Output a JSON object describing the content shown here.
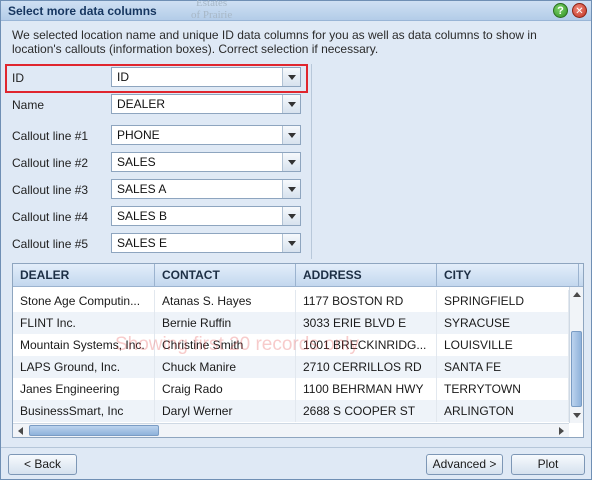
{
  "window": {
    "title": "Select more data columns",
    "map_ghost_line1": "Estates",
    "map_ghost_line2": "of Prairie",
    "help_symbol": "?",
    "close_symbol": "✕"
  },
  "intro_text": "We selected location name and unique ID data columns for you as well as data columns to show in location's callouts (information boxes). Correct selection if necessary.",
  "fields": [
    {
      "label": "ID",
      "value": "ID"
    },
    {
      "label": "Name",
      "value": "DEALER"
    },
    {
      "label": "Callout line #1",
      "value": "PHONE"
    },
    {
      "label": "Callout line #2",
      "value": "SALES"
    },
    {
      "label": "Callout line #3",
      "value": "SALES A"
    },
    {
      "label": "Callout line #4",
      "value": "SALES B"
    },
    {
      "label": "Callout line #5",
      "value": "SALES E"
    }
  ],
  "grid": {
    "columns": [
      "DEALER",
      "CONTACT",
      "ADDRESS",
      "CITY"
    ],
    "rows": [
      [
        "Stone Age Computin...",
        "Atanas S. Hayes",
        "1177 BOSTON RD",
        "SPRINGFIELD"
      ],
      [
        "FLINT Inc.",
        "Bernie Ruffin",
        "3033 ERIE BLVD E",
        "SYRACUSE"
      ],
      [
        "Mountain Systems, Inc.",
        "Christine Smith",
        "1001 BRECKINRIDG...",
        "LOUISVILLE"
      ],
      [
        "LAPS Ground, Inc.",
        "Chuck Manire",
        "2710 CERRILLOS RD",
        "SANTA FE"
      ],
      [
        "Janes Engineering",
        "Craig Rado",
        "1100 BEHRMAN HWY",
        "TERRYTOWN"
      ],
      [
        "BusinessSmart, Inc",
        "Daryl Werner",
        "2688 S COOPER ST",
        "ARLINGTON"
      ]
    ],
    "watermark": "Showing first 20 records only"
  },
  "buttons": {
    "back": "< Back",
    "advanced": "Advanced >",
    "plot": "Plot"
  },
  "colors": {
    "highlight": "#e0262e",
    "accent": "#8fb2db"
  }
}
